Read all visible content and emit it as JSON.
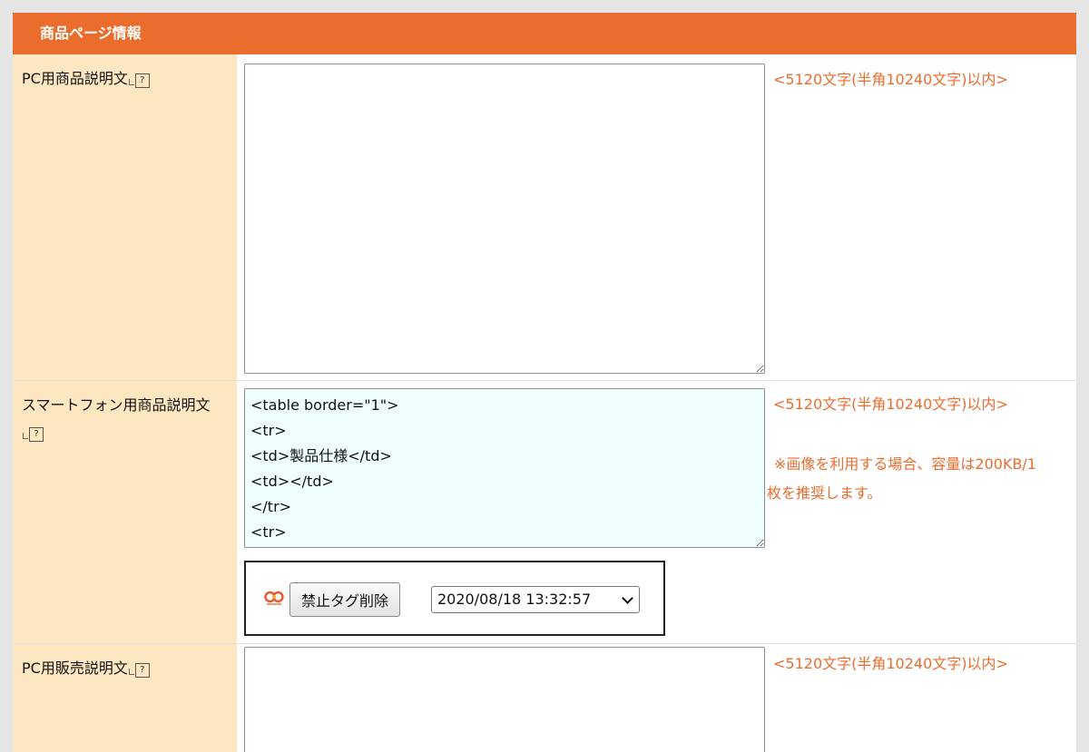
{
  "section": {
    "title": "商品ページ情報"
  },
  "rows": {
    "pc_description": {
      "label": "PC用商品説明文",
      "value": "",
      "note": "<5120文字(半角10240文字)以内>"
    },
    "sp_description": {
      "label": "スマートフォン用商品説明文",
      "value": "<table border=\"1\">\n<tr>\n<td>製品仕様</td>\n<td></td>\n</tr>\n<tr>\n<td>",
      "note": "<5120文字(半角10240文字)以内>",
      "note2": "※画像を利用する場合、容量は200KB/1枚を推奨します。",
      "tool": {
        "button_label": "禁止タグ削除",
        "selected_date": "2020/08/18 13:32:57"
      }
    },
    "pc_sales_description": {
      "label": "PC用販売説明文",
      "value": "",
      "note": "<5120文字(半角10240文字)以内>"
    }
  },
  "colors": {
    "header": "#ea6d2d",
    "label_bg": "#fce7c0",
    "note": "#ea6d2d",
    "sp_textarea_bg": "#eefdfe"
  }
}
